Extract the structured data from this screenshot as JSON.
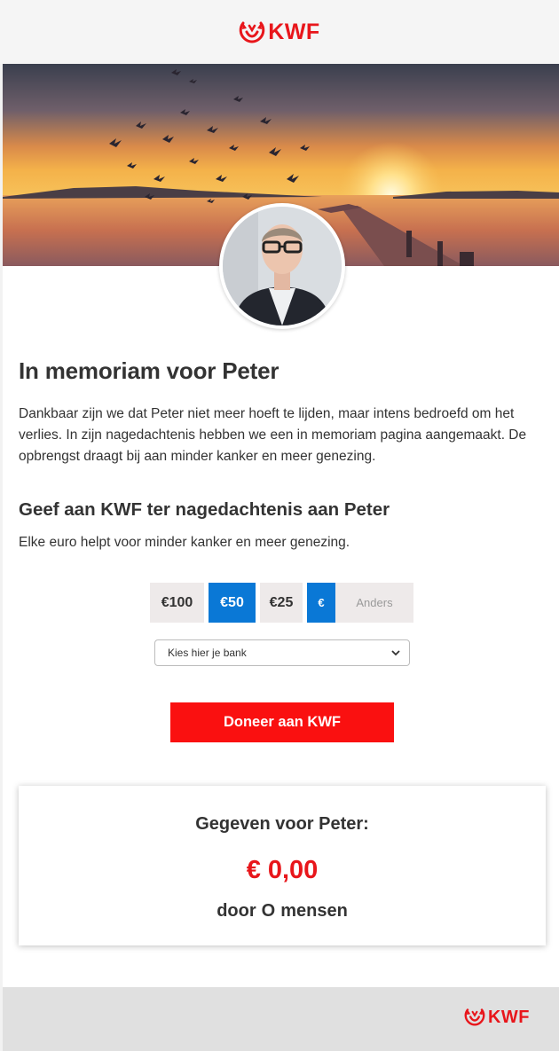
{
  "header": {
    "logo_text": "KWF",
    "logo_icon": "kwf-crab-logo-icon"
  },
  "hero": {
    "image": "sunset-lake-pier-with-birds",
    "avatar": "portrait-man-glasses"
  },
  "memorial": {
    "title": "In memoriam voor Peter",
    "text": "Dankbaar zijn we dat Peter niet meer hoeft te lijden, maar intens bedroefd om het verlies. In zijn nagedachtenis hebben we een in memoriam pagina aangemaakt. De opbrengst draagt bij aan minder kanker en meer genezing."
  },
  "donate": {
    "title": "Geef aan KWF ter nagedachtenis aan Peter",
    "subtitle": "Elke euro helpt voor minder kanker en meer genezing.",
    "amounts": [
      "€100",
      "€50",
      "€25"
    ],
    "selected_amount": "€50",
    "other_prefix": "€",
    "other_placeholder": "Anders",
    "bank_select": "Kies hier je bank",
    "button_label": "Doneer aan KWF"
  },
  "total": {
    "label": "Gegeven voor Peter:",
    "currency": "€",
    "amount": "0,00",
    "people_prefix": "door",
    "people_count": "O",
    "people_suffix": "mensen"
  },
  "footer": {
    "logo_text": "KWF"
  },
  "colors": {
    "brand_red": "#e8161b",
    "button_red": "#fa1010",
    "selected_blue": "#0a78d6",
    "option_grey": "#eeeaea",
    "footer_grey": "#e0e0e0"
  }
}
